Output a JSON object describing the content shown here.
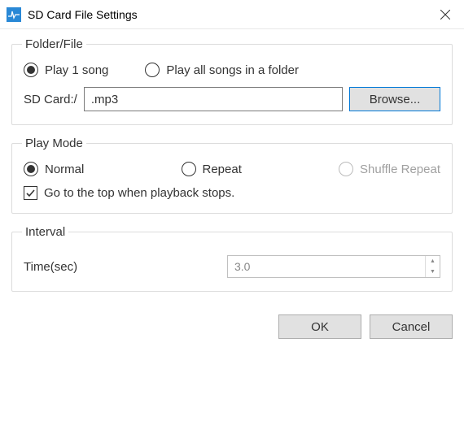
{
  "window": {
    "title": "SD Card File Settings"
  },
  "folderFile": {
    "legend": "Folder/File",
    "play1song": "Play 1 song",
    "playAll": "Play all songs in a folder",
    "pathLabel": "SD Card:/",
    "pathValue": ".mp3",
    "browse": "Browse..."
  },
  "playMode": {
    "legend": "Play Mode",
    "normal": "Normal",
    "repeat": "Repeat",
    "shuffle": "Shuffle Repeat",
    "goToTop": "Go to the top when playback stops."
  },
  "interval": {
    "legend": "Interval",
    "timeLabel": "Time(sec)",
    "timeValue": "3.0"
  },
  "buttons": {
    "ok": "OK",
    "cancel": "Cancel"
  }
}
